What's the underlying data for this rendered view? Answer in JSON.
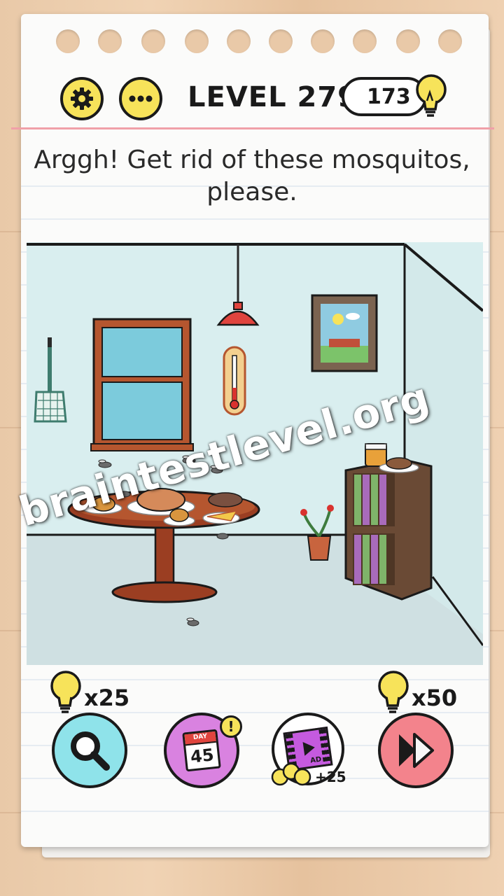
{
  "header": {
    "level_label": "LEVEL 279",
    "hint_count": "173",
    "settings_icon": "gear-icon",
    "menu_icon": "ellipsis-icon",
    "hint_icon": "lightbulb-icon"
  },
  "question": {
    "line1": "Arggh! Get rid of these mosquitos,",
    "line2": "please."
  },
  "scene": {
    "objects": [
      "fly swatter",
      "window",
      "ceiling lamp",
      "thermometer",
      "picture frame",
      "table with food",
      "mosquitos",
      "plant pot",
      "bookshelf",
      "honey jar",
      "bread plate"
    ]
  },
  "toolbar": {
    "search_cost": "x25",
    "daily_day_label": "DAY",
    "daily_number": "45",
    "daily_badge": "!",
    "video_label": "AD",
    "video_reward": "+25",
    "skip_cost": "x50"
  },
  "watermark": "braintestlevel.org",
  "colors": {
    "accent_yellow": "#f7e35a",
    "search_bg": "#8fe3ea",
    "daily_bg": "#d982e0",
    "skip_bg": "#f3838c",
    "wall": "#d9eeef",
    "floor": "#cfe0e2"
  }
}
